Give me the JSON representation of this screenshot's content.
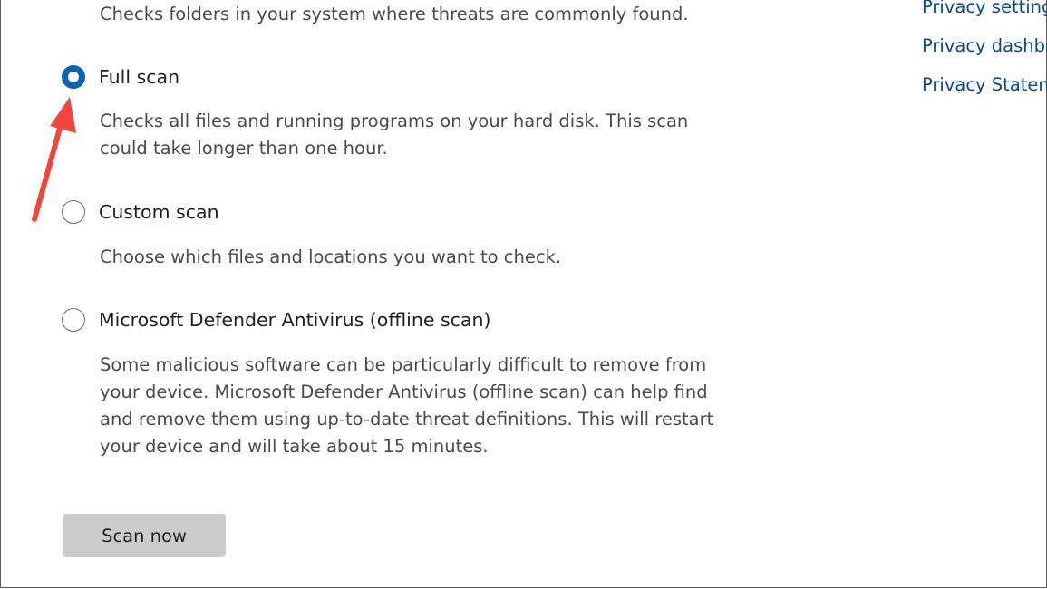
{
  "intro": {
    "quick_scan_desc": "Checks folders in your system where threats are commonly found."
  },
  "scan_options": [
    {
      "label": "Full scan",
      "checked": true,
      "description_lines": [
        "Checks all files and running programs on your hard disk. This scan",
        "could take longer than one hour."
      ]
    },
    {
      "label": "Custom scan",
      "checked": false,
      "description_lines": [
        "Choose which files and locations you want to check."
      ]
    },
    {
      "label": "Microsoft Defender Antivirus (offline scan)",
      "checked": false,
      "description_lines": [
        "Some malicious software can be particularly difficult to remove from",
        "your device. Microsoft Defender Antivirus (offline scan) can help find",
        "and remove them using up-to-date threat definitions. This will restart",
        "your device and will take about 15 minutes."
      ]
    }
  ],
  "scan_button": {
    "label": "Scan now"
  },
  "privacy_links": [
    "Privacy settings",
    "Privacy dashboard",
    "Privacy Statement"
  ],
  "colors": {
    "accent": "#0a63b8",
    "link": "#0b4a8f",
    "annotation_arrow": "#f0463c",
    "button_bg": "#cccccc"
  }
}
